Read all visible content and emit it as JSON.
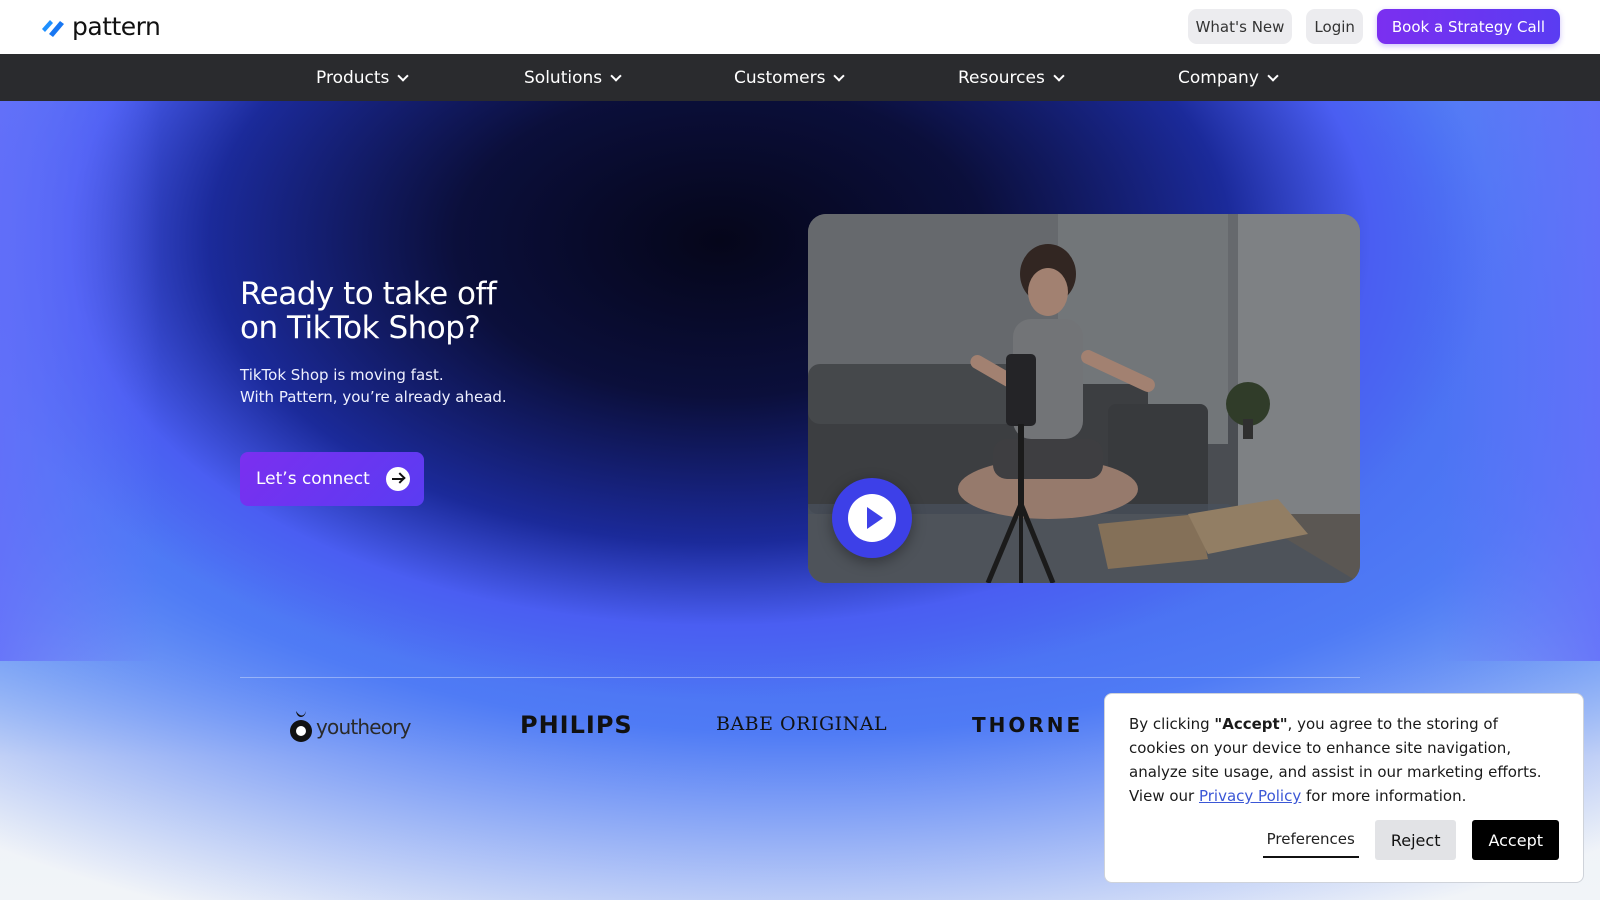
{
  "brand": {
    "name": "pattern"
  },
  "header": {
    "whats_new": "What's New",
    "login": "Login",
    "cta": "Book a Strategy Call",
    "accent": "#6b35f0"
  },
  "nav": {
    "items": [
      {
        "label": "Products"
      },
      {
        "label": "Solutions"
      },
      {
        "label": "Customers"
      },
      {
        "label": "Resources"
      },
      {
        "label": "Company"
      }
    ]
  },
  "hero": {
    "title_line1": "Ready to take off",
    "title_line2": "on TikTok Shop?",
    "sub_line1": "TikTok Shop is moving fast.",
    "sub_line2": "With Pattern, you’re already ahead.",
    "cta": "Let’s connect",
    "video_icon": "play-icon"
  },
  "logos": [
    {
      "name": "youtheory"
    },
    {
      "name": "PHILIPS"
    },
    {
      "name": "BABE ORIGINAL"
    },
    {
      "name": "THORNE"
    }
  ],
  "cookie": {
    "text_before": "By clicking ",
    "accept_word": "\"Accept\"",
    "text_middle": ", you agree to the storing of cookies on your device to enhance site navigation, analyze site usage, and assist in our marketing efforts. View our ",
    "privacy_link": "Privacy Policy",
    "text_after": " for more information.",
    "preferences": "Preferences",
    "reject": "Reject",
    "accept": "Accept"
  }
}
